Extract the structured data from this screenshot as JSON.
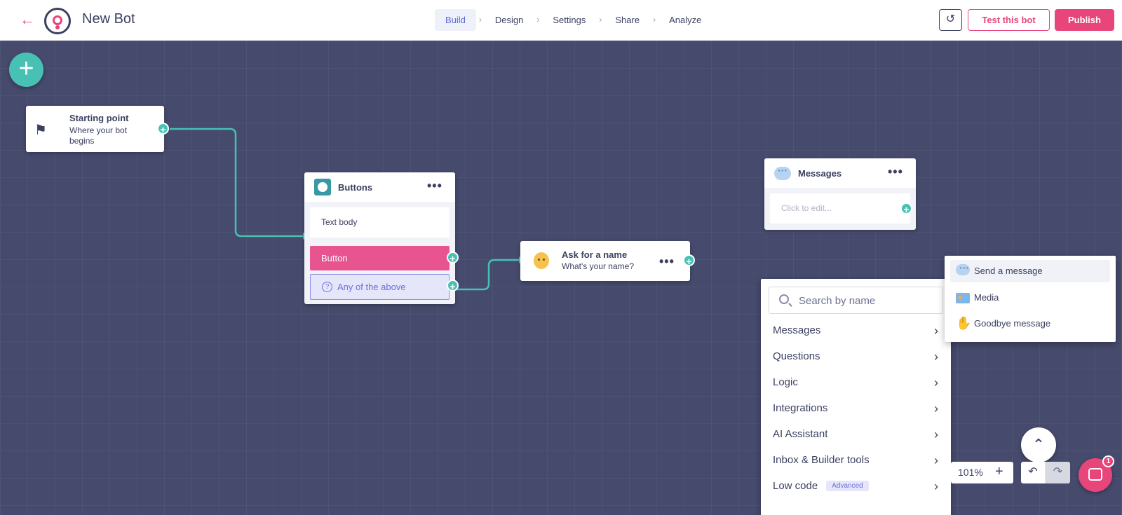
{
  "header": {
    "bot_name": "New Bot",
    "steps": [
      "Build",
      "Design",
      "Settings",
      "Share",
      "Analyze"
    ],
    "active_step": "Build",
    "test_label": "Test this bot",
    "publish_label": "Publish"
  },
  "nodes": {
    "start": {
      "title": "Starting point",
      "subtitle": "Where your bot begins"
    },
    "buttons": {
      "title": "Buttons",
      "text_body": "Text body",
      "button_label": "Button",
      "fallback_label": "Any of the above"
    },
    "ask": {
      "title": "Ask for a name",
      "subtitle": "What's your name?"
    },
    "messages": {
      "title": "Messages",
      "placeholder": "Click to edit..."
    }
  },
  "menu": {
    "search_placeholder": "Search by name",
    "items": [
      {
        "label": "Messages"
      },
      {
        "label": "Questions"
      },
      {
        "label": "Logic"
      },
      {
        "label": "Integrations"
      },
      {
        "label": "AI Assistant"
      },
      {
        "label": "Inbox & Builder tools"
      },
      {
        "label": "Low code",
        "badge": "Advanced"
      }
    ]
  },
  "submenu": {
    "items": [
      {
        "label": "Send a message",
        "icon": "speech-bubble-icon"
      },
      {
        "label": "Media",
        "icon": "image-icon"
      },
      {
        "label": "Goodbye message",
        "icon": "waving-hand-icon"
      }
    ]
  },
  "controls": {
    "zoom": "101%",
    "notification_count": "1"
  },
  "colors": {
    "accent": "#e8457b",
    "teal": "#48c1b5",
    "canvas": "#464a6c",
    "button_pink": "#e75490",
    "fallback_purple": "#6a6fd8"
  }
}
